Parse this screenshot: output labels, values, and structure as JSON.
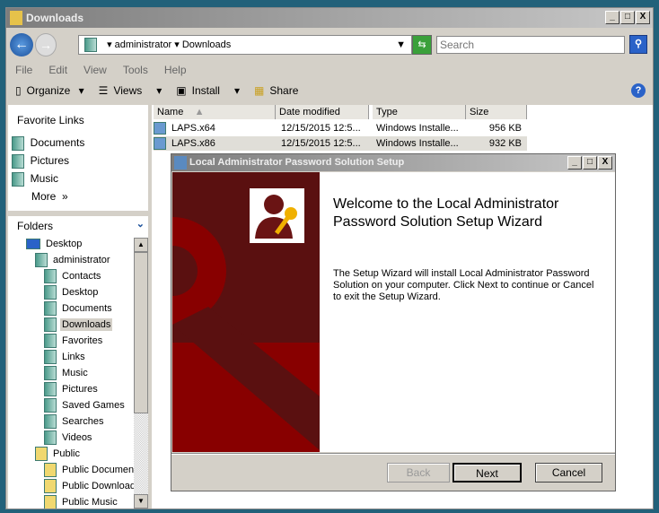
{
  "window": {
    "title": "Downloads",
    "buttons": [
      "_",
      "□",
      "X"
    ]
  },
  "address": {
    "path": [
      "administrator",
      "Downloads"
    ],
    "search_placeholder": "Search"
  },
  "menu": [
    "File",
    "Edit",
    "View",
    "Tools",
    "Help"
  ],
  "toolbar": {
    "organize": "Organize",
    "views": "Views",
    "install": "Install",
    "share": "Share"
  },
  "favorites": {
    "title": "Favorite Links",
    "items": [
      "Documents",
      "Pictures",
      "Music"
    ],
    "more": "More"
  },
  "folders": {
    "title": "Folders",
    "items": [
      {
        "label": "Desktop",
        "level": 0
      },
      {
        "label": "administrator",
        "level": 1
      },
      {
        "label": "Contacts",
        "level": 2
      },
      {
        "label": "Desktop",
        "level": 2
      },
      {
        "label": "Documents",
        "level": 2
      },
      {
        "label": "Downloads",
        "level": 2,
        "selected": true
      },
      {
        "label": "Favorites",
        "level": 2
      },
      {
        "label": "Links",
        "level": 2
      },
      {
        "label": "Music",
        "level": 2
      },
      {
        "label": "Pictures",
        "level": 2
      },
      {
        "label": "Saved Games",
        "level": 2
      },
      {
        "label": "Searches",
        "level": 2
      },
      {
        "label": "Videos",
        "level": 2
      },
      {
        "label": "Public",
        "level": 1
      },
      {
        "label": "Public Documents",
        "level": 2
      },
      {
        "label": "Public Downloads",
        "level": 2
      },
      {
        "label": "Public Music",
        "level": 2
      }
    ]
  },
  "columns": [
    "Name",
    "Date modified",
    "Type",
    "Size"
  ],
  "files": [
    {
      "name": "LAPS.x64",
      "date": "12/15/2015 12:5...",
      "type": "Windows Installe...",
      "size": "956 KB"
    },
    {
      "name": "LAPS.x86",
      "date": "12/15/2015 12:5...",
      "type": "Windows Installe...",
      "size": "932 KB"
    }
  ],
  "dialog": {
    "title": "Local Administrator Password Solution Setup",
    "heading": "Welcome to the Local Administrator Password Solution Setup Wizard",
    "body": "The Setup Wizard will install Local Administrator Password Solution on your computer. Click Next to continue or Cancel to exit the Setup Wizard.",
    "back": "Back",
    "next": "Next",
    "cancel": "Cancel"
  },
  "colors": {
    "banner": "#7a0000",
    "accent": "#f0b000"
  }
}
